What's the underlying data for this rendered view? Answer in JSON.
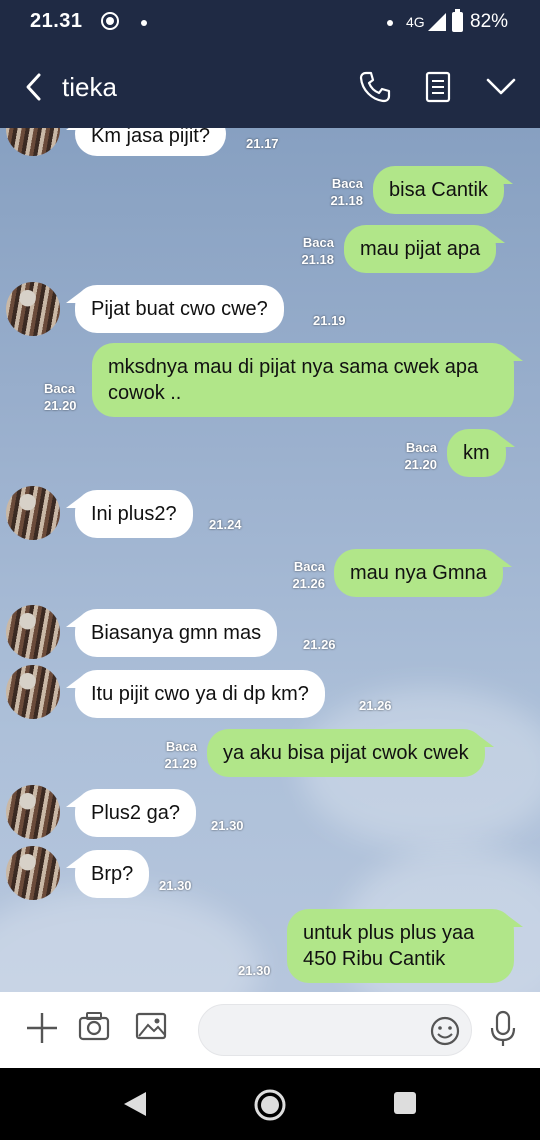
{
  "status_bar": {
    "time": "21.31",
    "network": "4G",
    "battery": "82%"
  },
  "header": {
    "title": "tieka"
  },
  "messages": [
    {
      "side": "in",
      "text": "Km jasa pijit?",
      "time": "21.17"
    },
    {
      "side": "out",
      "text": "bisa Cantik",
      "read": "Baca",
      "time": "21.18"
    },
    {
      "side": "out",
      "text": "mau pijat apa",
      "read": "Baca",
      "time": "21.18"
    },
    {
      "side": "in",
      "text": "Pijat buat cwo cwe?",
      "time": "21.19"
    },
    {
      "side": "out",
      "text": "mksdnya mau di pijat nya sama cwek apa cowok ..",
      "read": "Baca",
      "time": "21.20"
    },
    {
      "side": "out",
      "text": "km",
      "read": "Baca",
      "time": "21.20"
    },
    {
      "side": "in",
      "text": "Ini plus2?",
      "time": "21.24"
    },
    {
      "side": "out",
      "text": "mau nya Gmna",
      "read": "Baca",
      "time": "21.26"
    },
    {
      "side": "in",
      "text": "Biasanya gmn mas",
      "time": "21.26"
    },
    {
      "side": "in",
      "text": "Itu pijit cwo ya di dp km?",
      "time": "21.26"
    },
    {
      "side": "out",
      "text": "ya aku bisa pijat cwok cwek",
      "read": "Baca",
      "time": "21.29"
    },
    {
      "side": "in",
      "text": "Plus2 ga?",
      "time": "21.30"
    },
    {
      "side": "in",
      "text": "Brp?",
      "time": "21.30"
    },
    {
      "side": "out",
      "text": "untuk plus plus yaa 450 Ribu Cantik",
      "time": "21.30"
    }
  ],
  "input": {
    "placeholder": ""
  },
  "colors": {
    "header_bg": "#1f2a44",
    "outgoing_bubble": "#b1e689",
    "incoming_bubble": "#ffffff"
  }
}
